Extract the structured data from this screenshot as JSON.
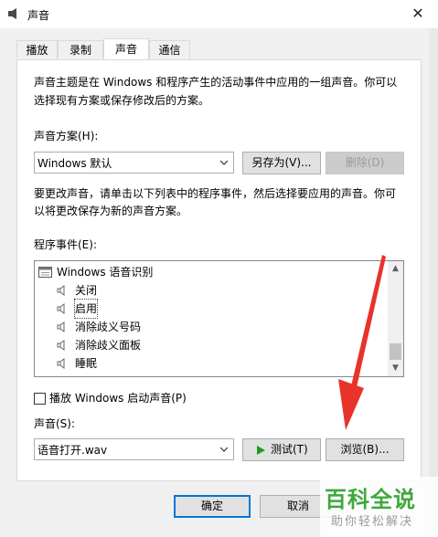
{
  "window": {
    "title": "声音",
    "close_glyph": "✕"
  },
  "tabs": [
    {
      "label": "播放"
    },
    {
      "label": "录制"
    },
    {
      "label": "声音"
    },
    {
      "label": "通信"
    }
  ],
  "sounds": {
    "intro_line1": "声音主题是在 Windows 和程序产生的活动事件中应用的一组声音。你可以",
    "intro_line2": "选择现有方案或保存修改后的方案。",
    "scheme_label": "声音方案(H):",
    "scheme_value": "Windows 默认",
    "save_as_label": "另存为(V)...",
    "delete_label": "删除(D)",
    "change_line1": "要更改声音，请单击以下列表中的程序事件，然后选择要应用的声音。你可",
    "change_line2": "以将更改保存为新的声音方案。",
    "events_label": "程序事件(E):",
    "events": [
      {
        "label": "Windows 语音识别",
        "type": "group"
      },
      {
        "label": "关闭",
        "type": "item"
      },
      {
        "label": "启用",
        "type": "item"
      },
      {
        "label": "消除歧义号码",
        "type": "item"
      },
      {
        "label": "消除歧义面板",
        "type": "item"
      },
      {
        "label": "睡眠",
        "type": "item"
      }
    ],
    "play_startup_label": "播放 Windows 启动声音(P)",
    "sound_label": "声音(S):",
    "sound_value": "语音打开.wav",
    "test_label": "测试(T)",
    "browse_label": "浏览(B)..."
  },
  "footer": {
    "ok_label": "确定",
    "cancel_label": "取消"
  },
  "watermark": {
    "brand": "百科全说",
    "slogan": "助你轻松解决"
  },
  "colors": {
    "arrow_red": "#e8332a",
    "watermark_green": "#3ea83b",
    "accent_blue": "#0078d7",
    "play_green": "#1e9a1e"
  }
}
